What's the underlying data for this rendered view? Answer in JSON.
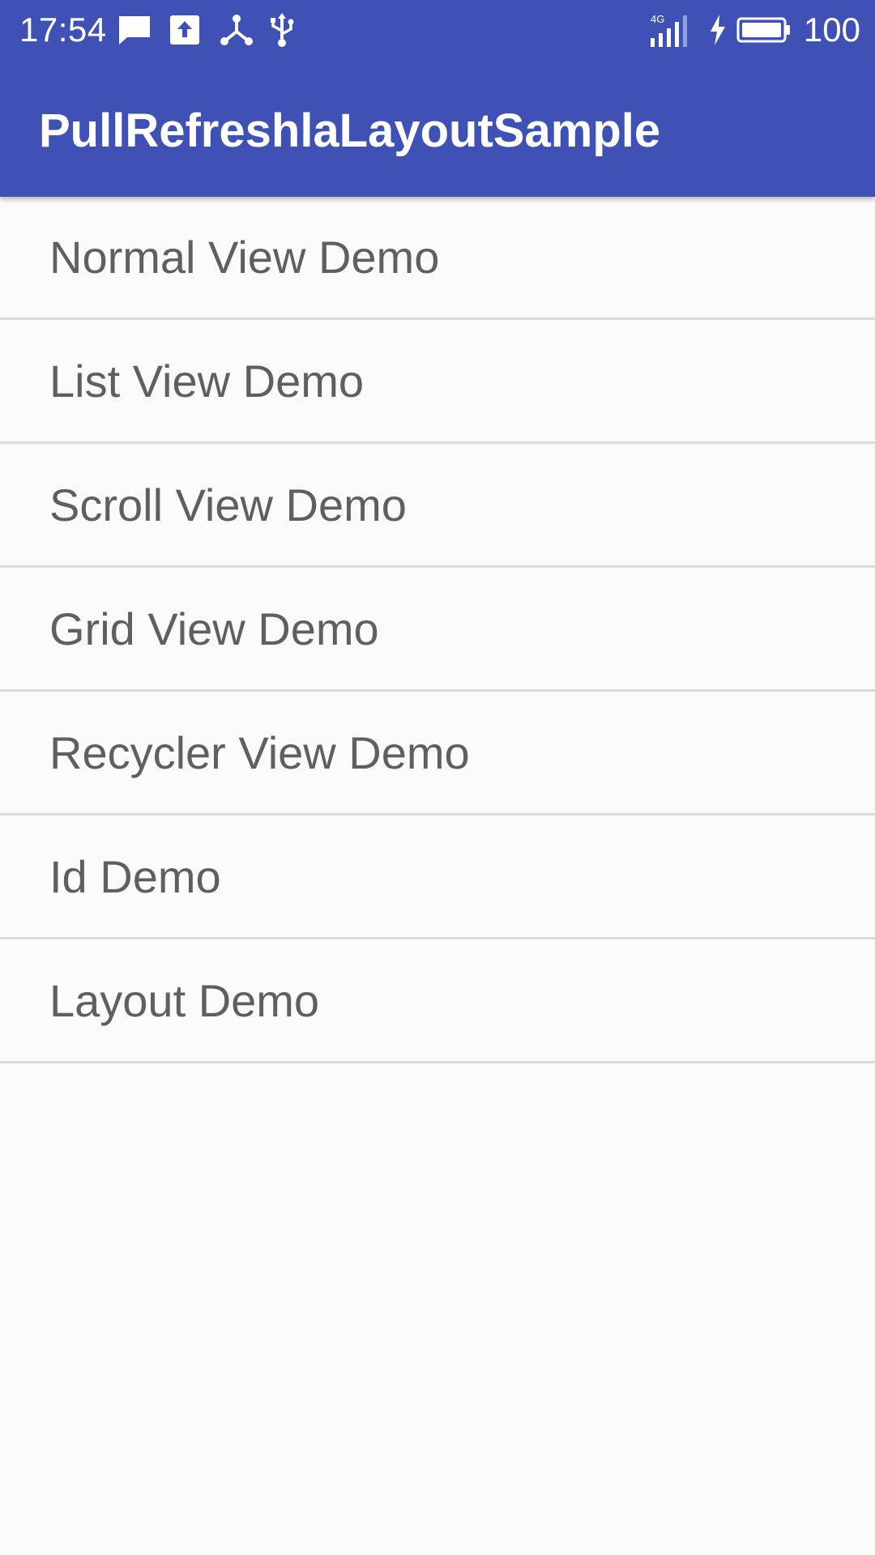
{
  "status_bar": {
    "time": "17:54",
    "icons": [
      "message-icon",
      "upload-icon",
      "network-share-icon",
      "usb-icon"
    ],
    "network": "4G",
    "battery": "100"
  },
  "app_bar": {
    "title": "PullRefreshlaLayoutSample",
    "color": "#3f51b5"
  },
  "list": {
    "items": [
      {
        "label": "Normal View Demo"
      },
      {
        "label": "List View Demo"
      },
      {
        "label": "Scroll View Demo"
      },
      {
        "label": "Grid View Demo"
      },
      {
        "label": "Recycler View Demo"
      },
      {
        "label": "Id Demo"
      },
      {
        "label": "Layout Demo"
      }
    ]
  }
}
